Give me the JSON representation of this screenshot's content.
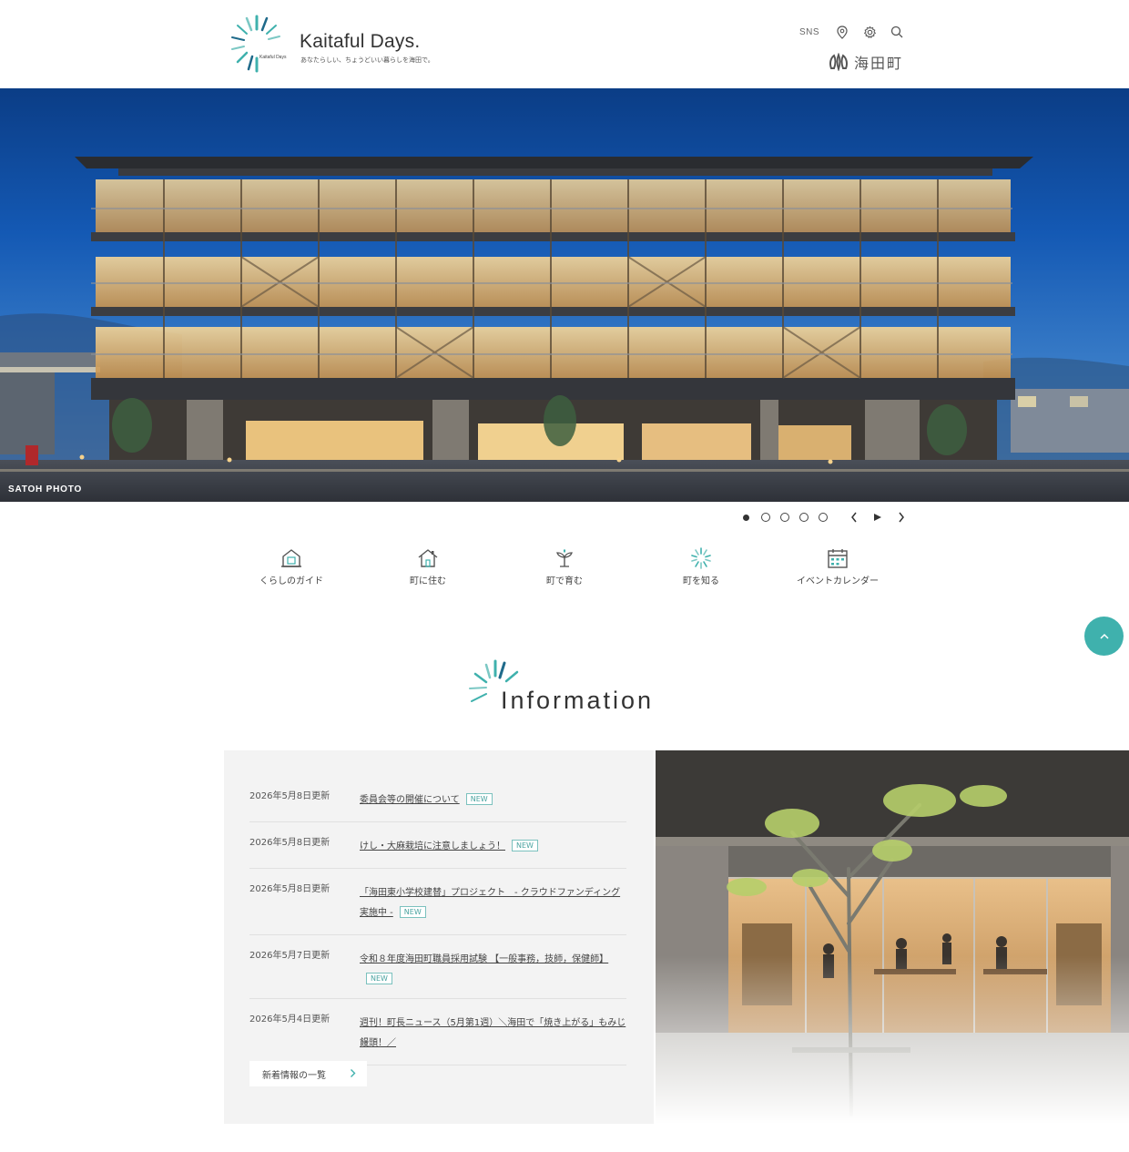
{
  "header": {
    "logo_title": "Kaitaful Days.",
    "logo_mark_text": "Kaitaful Days",
    "logo_subtitle": "あなたらしい、ちょうどいい暮らしを海田で。",
    "sns_label": "SNS",
    "town_name": "海田町",
    "icons": [
      "map-pin-icon",
      "gear-icon",
      "search-icon"
    ]
  },
  "hero": {
    "credit": "SATOH PHOTO",
    "slide_count": 5,
    "active_slide": 1
  },
  "categories": [
    {
      "label": "くらしのガイド",
      "icon": "house-guide-icon"
    },
    {
      "label": "町に住む",
      "icon": "house-icon"
    },
    {
      "label": "町で育む",
      "icon": "sprout-icon"
    },
    {
      "label": "町を知る",
      "icon": "burst-icon"
    },
    {
      "label": "イベントカレンダー",
      "icon": "calendar-icon"
    }
  ],
  "information": {
    "heading": "Information",
    "items": [
      {
        "date": "2026年5月8日更新",
        "title": "委員会等の開催について",
        "badge": "NEW"
      },
      {
        "date": "2026年5月8日更新",
        "title": "けし・大麻栽培に注意しましょう！",
        "badge": "NEW"
      },
      {
        "date": "2026年5月8日更新",
        "title": "「海田東小学校建替」プロジェクト　- クラウドファンディング実施中 -",
        "badge": "NEW"
      },
      {
        "date": "2026年5月7日更新",
        "title": "令和８年度海田町職員採用試験 【一般事務，技師，保健師】",
        "badge": "NEW"
      },
      {
        "date": "2026年5月4日更新",
        "title": "週刊！町長ニュース（5月第1週）＼海田で「焼き上がる」もみじ饅頭！／",
        "badge": ""
      }
    ],
    "more_label": "新着情報の一覧"
  },
  "colors": {
    "accent": "#3fb1ad",
    "panel_bg": "#f3f3f3",
    "sky": "#1459b4"
  }
}
